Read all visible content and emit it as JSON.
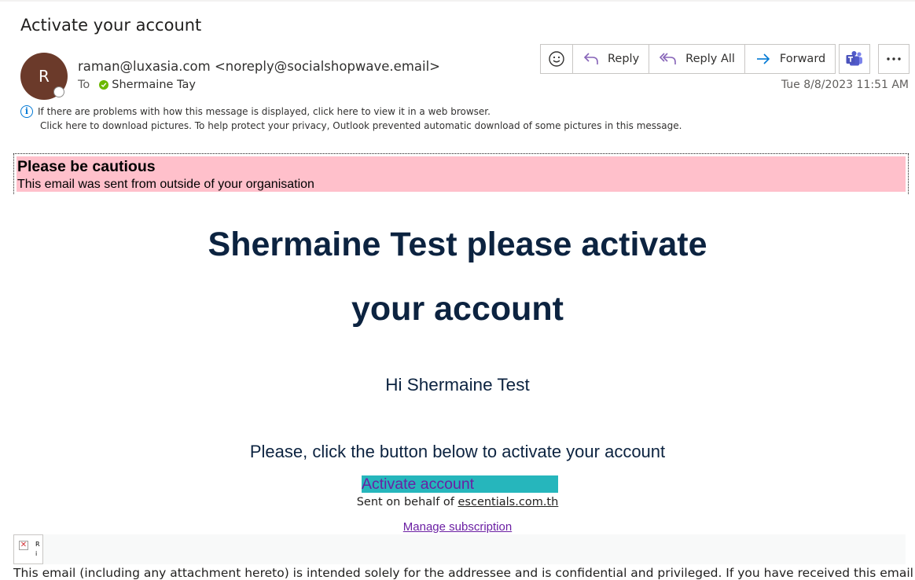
{
  "subject": "Activate your account",
  "sender": {
    "avatar_initial": "R",
    "from": "raman@luxasia.com <noreply@socialshopwave.email>",
    "to_label": "To",
    "to_name": "Shermaine Tay"
  },
  "toolbar": {
    "reply_label": "Reply",
    "reply_all_label": "Reply All",
    "forward_label": "Forward"
  },
  "date": "Tue 8/8/2023 11:51 AM",
  "infobar": {
    "line1": "If there are problems with how this message is displayed, click here to view it in a web browser.",
    "line2": "Click here to download pictures. To help protect your privacy, Outlook prevented automatic download of some pictures in this message."
  },
  "caution": {
    "heading": "Please be cautious",
    "text": "This email was sent from outside of your organisation"
  },
  "body": {
    "headline_line1": "Shermaine Test please activate",
    "headline_line2": "your account",
    "greeting": "Hi Shermaine Test",
    "instruction": "Please, click the button below to activate your account",
    "cta_label": "Activate account",
    "behalf_prefix": "Sent on behalf of ",
    "behalf_link": "escentials.com.th",
    "manage_label": "Manage subscription",
    "broken_image_alt": "R i",
    "disclaimer": "This email (including any attachment hereto) is intended solely for the addressee and is confidential and privileged. If you have received this email in"
  },
  "colors": {
    "caution_bg": "#ffc0cb",
    "headline": "#0c2340",
    "cta_bg": "#26b6bc",
    "cta_text": "#6b1fa3",
    "avatar_bg": "#6b3a2a",
    "reply_icon": "#8764b8",
    "forward_icon": "#0078d4"
  }
}
